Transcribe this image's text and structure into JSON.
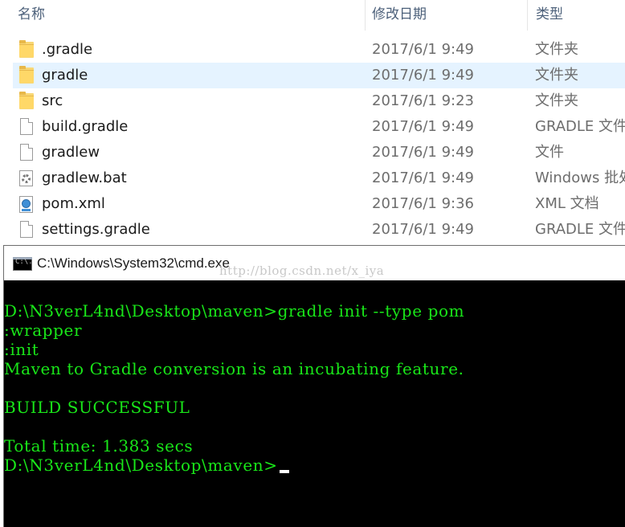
{
  "explorer": {
    "columns": {
      "name": "名称",
      "date": "修改日期",
      "type": "类型"
    },
    "rows": [
      {
        "name": ".gradle",
        "date": "2017/6/1 9:49",
        "type": "文件夹",
        "icon": "folder-icon"
      },
      {
        "name": "gradle",
        "date": "2017/6/1 9:49",
        "type": "文件夹",
        "icon": "folder-icon"
      },
      {
        "name": "src",
        "date": "2017/6/1 9:23",
        "type": "文件夹",
        "icon": "folder-icon"
      },
      {
        "name": "build.gradle",
        "date": "2017/6/1 9:49",
        "type": "GRADLE 文件",
        "icon": "file-icon"
      },
      {
        "name": "gradlew",
        "date": "2017/6/1 9:49",
        "type": "文件",
        "icon": "file-icon"
      },
      {
        "name": "gradlew.bat",
        "date": "2017/6/1 9:49",
        "type": "Windows 批处",
        "icon": "bat-file-icon"
      },
      {
        "name": "pom.xml",
        "date": "2017/6/1 9:36",
        "type": "XML 文档",
        "icon": "xml-file-icon"
      },
      {
        "name": "settings.gradle",
        "date": "2017/6/1 9:49",
        "type": "GRADLE 文件",
        "icon": "file-icon"
      }
    ]
  },
  "cmd": {
    "title": "C:\\Windows\\System32\\cmd.exe",
    "icon_glyph": "C:\\.",
    "watermark": "http://blog.csdn.net/x_iya",
    "lines": [
      "D:\\N3verL4nd\\Desktop\\maven>gradle init --type pom",
      ":wrapper",
      ":init",
      "Maven to Gradle conversion is an incubating feature.",
      "",
      "BUILD SUCCESSFUL",
      "",
      "Total time: 1.383 secs",
      "D:\\N3verL4nd\\Desktop\\maven>"
    ]
  },
  "colors": {
    "console_text": "#19e619",
    "console_bg": "#000000",
    "selected_row": "#e5f3ff",
    "header_text": "#4c607a"
  }
}
